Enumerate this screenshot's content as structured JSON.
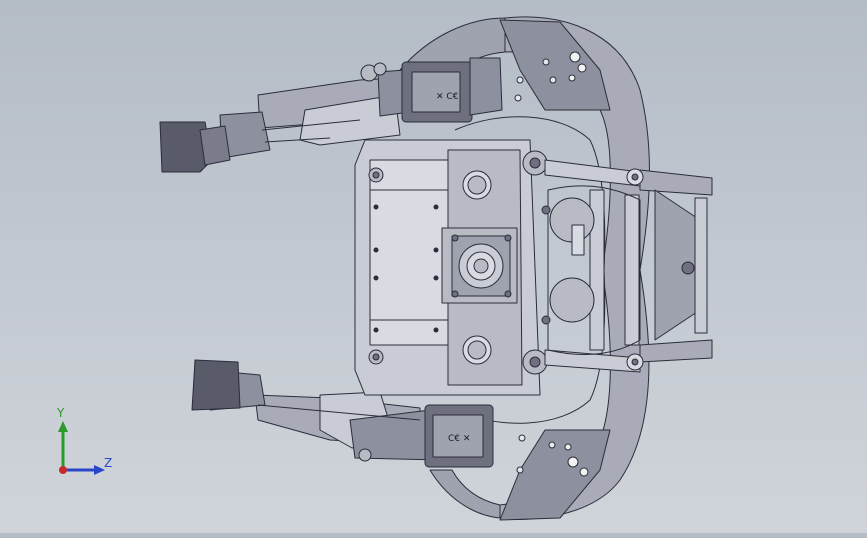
{
  "viewport": {
    "background_top": "#b4bcc6",
    "background_bottom": "#d0d4da",
    "model_stroke": "#2b2d3a",
    "model_fill": "#d9dbe2",
    "model_shade": "#a9acb8",
    "model_dark": "#6e7080"
  },
  "triad": {
    "y_label": "Y",
    "z_label": "Z",
    "y_color": "#2a9a2a",
    "z_color": "#2a46c8",
    "x_color": "#c82a2a"
  }
}
